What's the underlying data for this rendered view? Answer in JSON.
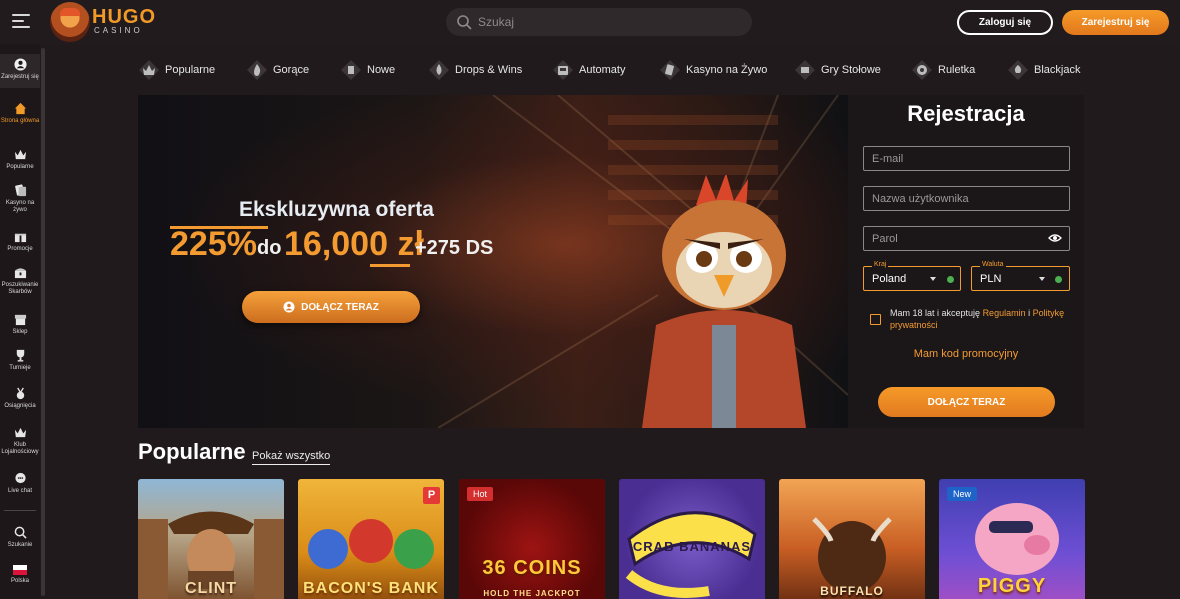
{
  "header": {
    "logo_text": "HUGO",
    "logo_sub": "CASINO",
    "search_placeholder": "Szukaj",
    "login_label": "Zaloguj się",
    "register_label": "Zarejestruj się"
  },
  "sidebar": {
    "items": [
      {
        "label": "Zarejestruj się",
        "icon": "user-circle-icon"
      },
      {
        "label": "Strona główna",
        "icon": "home-icon"
      },
      {
        "label": "Popularne",
        "icon": "crown-icon"
      },
      {
        "label": "Kasyno na żywo",
        "icon": "cards-icon"
      },
      {
        "label": "Promocje",
        "icon": "gift-icon"
      },
      {
        "label": "Poszukiwanie Skarbów",
        "icon": "treasure-icon"
      },
      {
        "label": "Sklep",
        "icon": "shop-icon"
      },
      {
        "label": "Turnieje",
        "icon": "trophy-icon"
      },
      {
        "label": "Osiągnięcia",
        "icon": "medal-icon"
      },
      {
        "label": "Klub Lojalnościowy",
        "icon": "loyalty-crown-icon"
      },
      {
        "label": "Live chat",
        "icon": "chat-icon"
      },
      {
        "label": "Szukanie",
        "icon": "search-icon"
      },
      {
        "label": "Polska",
        "icon": "poland-flag-icon"
      }
    ]
  },
  "categories": [
    {
      "label": "Popularne",
      "icon": "crown-icon"
    },
    {
      "label": "Gorące",
      "icon": "flame-icon"
    },
    {
      "label": "Nowe",
      "icon": "new-icon"
    },
    {
      "label": "Drops & Wins",
      "icon": "drops-icon"
    },
    {
      "label": "Automaty",
      "icon": "slot-machine-icon"
    },
    {
      "label": "Kasyno na Żywo",
      "icon": "live-casino-icon"
    },
    {
      "label": "Gry Stołowe",
      "icon": "table-games-icon"
    },
    {
      "label": "Ruletka",
      "icon": "roulette-icon"
    },
    {
      "label": "Blackjack",
      "icon": "blackjack-icon"
    }
  ],
  "hero": {
    "title": "Ekskluzywna oferta",
    "percent": "225%",
    "do": "do",
    "amount": "16,000 zł",
    "extra": "+275 DS",
    "button": "DOŁĄCZ TERAZ"
  },
  "registration": {
    "title": "Rejestracja",
    "email_placeholder": "E-mail",
    "username_placeholder": "Nazwa użytkownika",
    "password_placeholder": "Parol",
    "country_label": "Kraj",
    "country_value": "Poland",
    "currency_label": "Waluta",
    "currency_value": "PLN",
    "terms_text": "Mam 18 lat i akceptuję",
    "terms_link": "Regulamin",
    "terms_and": "i",
    "privacy_link": "Politykę prywatności",
    "promo_link": "Mam kod promocyjny",
    "submit": "DOŁĄCZ TERAZ"
  },
  "popular": {
    "title": "Popularne",
    "show_all": "Pokaż wszystko",
    "games": [
      {
        "name": "CLINT",
        "badge": ""
      },
      {
        "name": "BACON'S BANK",
        "badge": "P"
      },
      {
        "name": "36 COINS",
        "badge": "Hot",
        "sub": "HOLD THE JACKPOT"
      },
      {
        "name": "CRAB BANANAS",
        "badge": ""
      },
      {
        "name": "BUFFALO",
        "badge": ""
      },
      {
        "name": "PIGGY",
        "badge": "New"
      }
    ]
  },
  "colors": {
    "accent": "#f39b31",
    "background": "#201a1d",
    "hot_badge": "#d32f2f",
    "new_badge": "#1e63c8"
  }
}
